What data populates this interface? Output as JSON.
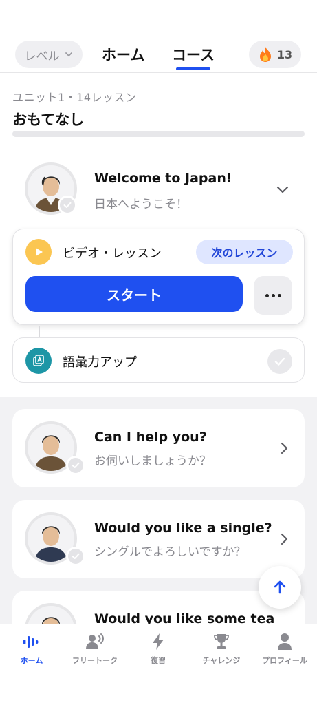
{
  "header": {
    "level_label": "レベル",
    "tabs": [
      {
        "label": "ホーム",
        "active": false
      },
      {
        "label": "コース",
        "active": true
      }
    ],
    "streak_count": "13",
    "accent_color": "#1f50f0"
  },
  "unit": {
    "subtitle": "ユニット1・14レッスン",
    "title": "おもてなし",
    "progress": 0
  },
  "expanded_lesson": {
    "title": "Welcome to Japan!",
    "subtitle": "日本へようこそ！",
    "video": {
      "label": "ビデオ・レッスン",
      "badge": "次のレッスン",
      "start_label": "スタート"
    },
    "vocab_label": "語彙力アップ"
  },
  "lessons": [
    {
      "title": "Can I help you?",
      "subtitle": "お伺いしましょうか？"
    },
    {
      "title": "Would you like a single?",
      "subtitle": "シングルでよろしいですか？"
    },
    {
      "title": "Would you like some tea",
      "subtitle": ""
    }
  ],
  "bottom_nav": [
    {
      "label": "ホーム",
      "icon": "waveform-icon",
      "active": true
    },
    {
      "label": "フリートーク",
      "icon": "speaking-person-icon",
      "active": false
    },
    {
      "label": "復習",
      "icon": "lightning-icon",
      "active": false
    },
    {
      "label": "チャレンジ",
      "icon": "trophy-icon",
      "active": false
    },
    {
      "label": "プロフィール",
      "icon": "person-icon",
      "active": false
    }
  ]
}
